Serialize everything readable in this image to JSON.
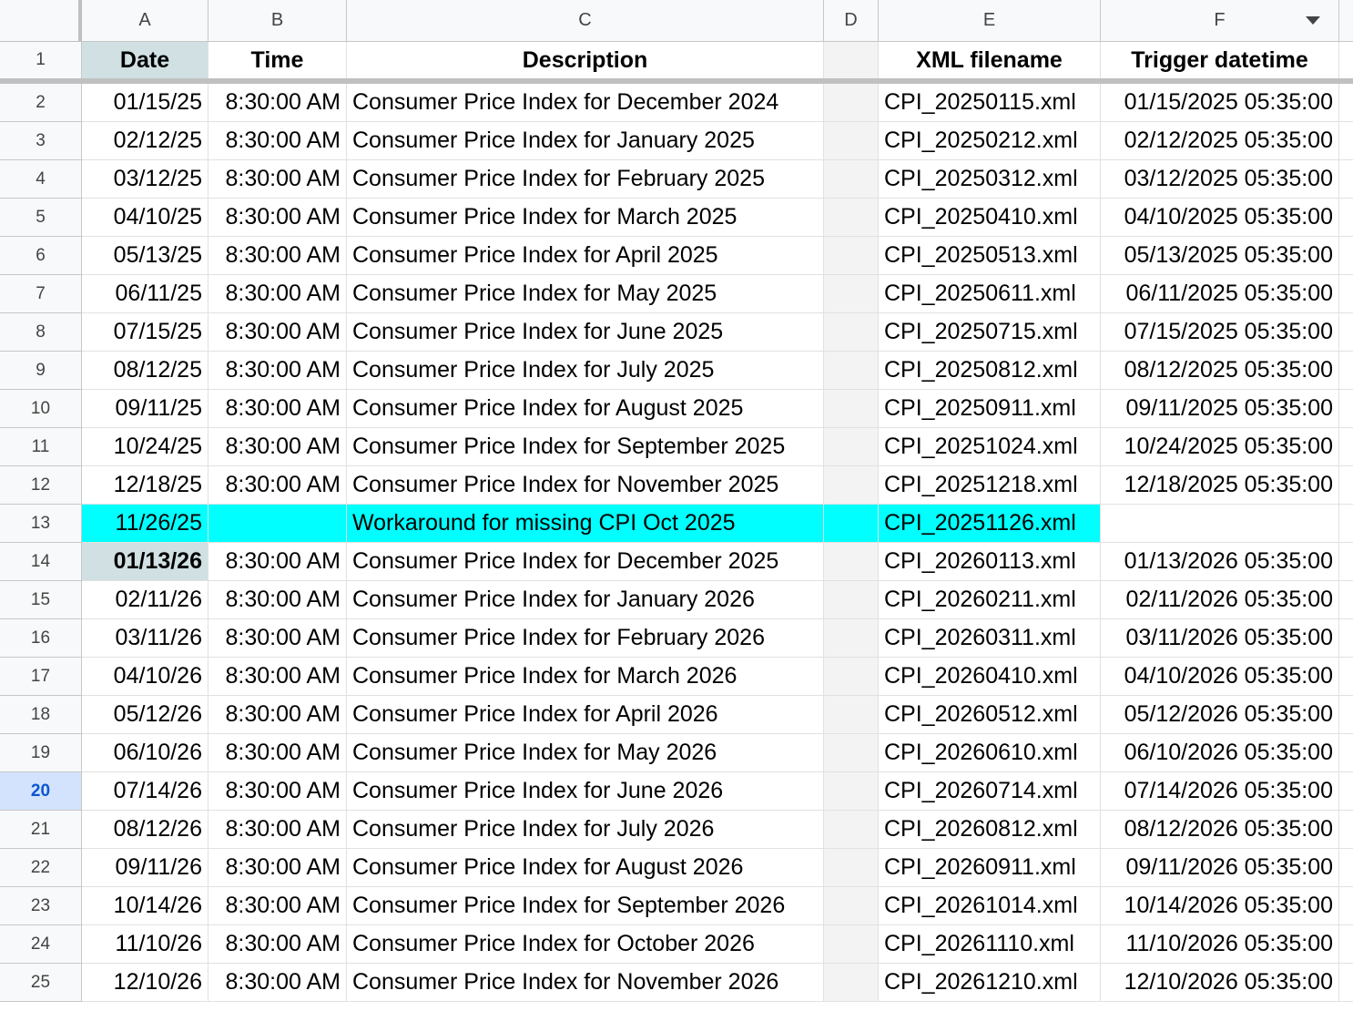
{
  "columns": [
    "A",
    "B",
    "C",
    "D",
    "E",
    "F"
  ],
  "header_row": {
    "row_number": "1",
    "date": "Date",
    "time": "Time",
    "description": "Description",
    "d": "",
    "xml": "XML filename",
    "trigger": "Trigger datetime"
  },
  "rows": [
    {
      "n": "2",
      "date": "01/15/25",
      "time": "8:30:00 AM",
      "desc": "Consumer Price Index for December 2024",
      "xml": "CPI_20250115.xml",
      "trigger": "01/15/2025 05:35:00"
    },
    {
      "n": "3",
      "date": "02/12/25",
      "time": "8:30:00 AM",
      "desc": "Consumer Price Index for January 2025",
      "xml": "CPI_20250212.xml",
      "trigger": "02/12/2025 05:35:00"
    },
    {
      "n": "4",
      "date": "03/12/25",
      "time": "8:30:00 AM",
      "desc": "Consumer Price Index for February 2025",
      "xml": "CPI_20250312.xml",
      "trigger": "03/12/2025 05:35:00"
    },
    {
      "n": "5",
      "date": "04/10/25",
      "time": "8:30:00 AM",
      "desc": "Consumer Price Index for March 2025",
      "xml": "CPI_20250410.xml",
      "trigger": "04/10/2025 05:35:00"
    },
    {
      "n": "6",
      "date": "05/13/25",
      "time": "8:30:00 AM",
      "desc": "Consumer Price Index for April 2025",
      "xml": "CPI_20250513.xml",
      "trigger": "05/13/2025 05:35:00"
    },
    {
      "n": "7",
      "date": "06/11/25",
      "time": "8:30:00 AM",
      "desc": "Consumer Price Index for May 2025",
      "xml": "CPI_20250611.xml",
      "trigger": "06/11/2025 05:35:00"
    },
    {
      "n": "8",
      "date": "07/15/25",
      "time": "8:30:00 AM",
      "desc": "Consumer Price Index for June 2025",
      "xml": "CPI_20250715.xml",
      "trigger": "07/15/2025 05:35:00"
    },
    {
      "n": "9",
      "date": "08/12/25",
      "time": "8:30:00 AM",
      "desc": "Consumer Price Index for July 2025",
      "xml": "CPI_20250812.xml",
      "trigger": "08/12/2025 05:35:00"
    },
    {
      "n": "10",
      "date": "09/11/25",
      "time": "8:30:00 AM",
      "desc": "Consumer Price Index for August 2025",
      "xml": "CPI_20250911.xml",
      "trigger": "09/11/2025 05:35:00"
    },
    {
      "n": "11",
      "date": "10/24/25",
      "time": "8:30:00 AM",
      "desc": "Consumer Price Index for September 2025",
      "xml": "CPI_20251024.xml",
      "trigger": "10/24/2025 05:35:00"
    },
    {
      "n": "12",
      "date": "12/18/25",
      "time": "8:30:00 AM",
      "desc": "Consumer Price Index for November 2025",
      "xml": "CPI_20251218.xml",
      "trigger": "12/18/2025 05:35:00"
    },
    {
      "n": "13",
      "date": "11/26/25",
      "time": "",
      "desc": "Workaround for missing CPI Oct 2025",
      "xml": "CPI_20251126.xml",
      "trigger": "",
      "highlight": true
    },
    {
      "n": "14",
      "date": "01/13/26",
      "time": "8:30:00 AM",
      "desc": "Consumer Price Index for December 2025",
      "xml": "CPI_20260113.xml",
      "trigger": "01/13/2026 05:35:00",
      "bold_date": true
    },
    {
      "n": "15",
      "date": "02/11/26",
      "time": "8:30:00 AM",
      "desc": "Consumer Price Index for January 2026",
      "xml": "CPI_20260211.xml",
      "trigger": "02/11/2026 05:35:00"
    },
    {
      "n": "16",
      "date": "03/11/26",
      "time": "8:30:00 AM",
      "desc": "Consumer Price Index for February 2026",
      "xml": "CPI_20260311.xml",
      "trigger": "03/11/2026 05:35:00"
    },
    {
      "n": "17",
      "date": "04/10/26",
      "time": "8:30:00 AM",
      "desc": "Consumer Price Index for March 2026",
      "xml": "CPI_20260410.xml",
      "trigger": "04/10/2026 05:35:00"
    },
    {
      "n": "18",
      "date": "05/12/26",
      "time": "8:30:00 AM",
      "desc": "Consumer Price Index for April 2026",
      "xml": "CPI_20260512.xml",
      "trigger": "05/12/2026 05:35:00"
    },
    {
      "n": "19",
      "date": "06/10/26",
      "time": "8:30:00 AM",
      "desc": "Consumer Price Index for May 2026",
      "xml": "CPI_20260610.xml",
      "trigger": "06/10/2026 05:35:00"
    },
    {
      "n": "20",
      "date": "07/14/26",
      "time": "8:30:00 AM",
      "desc": "Consumer Price Index for June 2026",
      "xml": "CPI_20260714.xml",
      "trigger": "07/14/2026 05:35:00",
      "active_row": true
    },
    {
      "n": "21",
      "date": "08/12/26",
      "time": "8:30:00 AM",
      "desc": "Consumer Price Index for July 2026",
      "xml": "CPI_20260812.xml",
      "trigger": "08/12/2026 05:35:00"
    },
    {
      "n": "22",
      "date": "09/11/26",
      "time": "8:30:00 AM",
      "desc": "Consumer Price Index for August 2026",
      "xml": "CPI_20260911.xml",
      "trigger": "09/11/2026 05:35:00"
    },
    {
      "n": "23",
      "date": "10/14/26",
      "time": "8:30:00 AM",
      "desc": "Consumer Price Index for September 2026",
      "xml": "CPI_20261014.xml",
      "trigger": "10/14/2026 05:35:00"
    },
    {
      "n": "24",
      "date": "11/10/26",
      "time": "8:30:00 AM",
      "desc": "Consumer Price Index for October 2026",
      "xml": "CPI_20261110.xml",
      "trigger": "11/10/2026 05:35:00"
    },
    {
      "n": "25",
      "date": "12/10/26",
      "time": "8:30:00 AM",
      "desc": "Consumer Price Index for November 2026",
      "xml": "CPI_20261210.xml",
      "trigger": "12/10/2026 05:35:00"
    }
  ],
  "colors": {
    "highlight": "#00ffff",
    "header_date_fill": "#d0e0e3",
    "active_row_number": "#d3e3fd"
  },
  "icons": {
    "filter_dropdown": "chevron-down-icon"
  }
}
